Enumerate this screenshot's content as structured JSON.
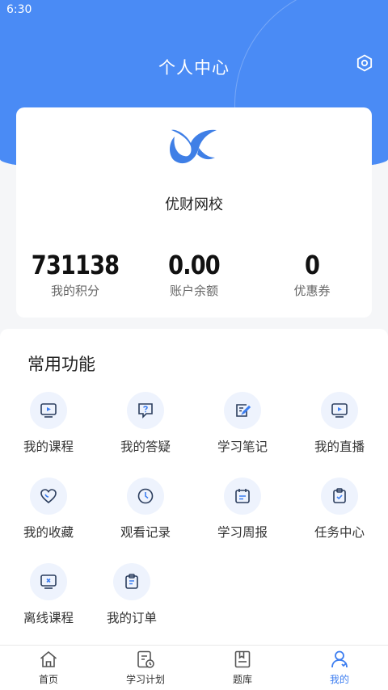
{
  "status_bar": {
    "time": "6:30"
  },
  "header": {
    "title": "个人中心"
  },
  "profile": {
    "school_name": "优财网校",
    "stats": [
      {
        "value": "731138",
        "label": "我的积分"
      },
      {
        "value": "0.00",
        "label": "账户余额"
      },
      {
        "value": "0",
        "label": "优惠券"
      }
    ]
  },
  "functions": {
    "title": "常用功能",
    "items": [
      {
        "label": "我的课程",
        "icon": "video-play-icon"
      },
      {
        "label": "我的答疑",
        "icon": "question-chat-icon"
      },
      {
        "label": "学习笔记",
        "icon": "note-edit-icon"
      },
      {
        "label": "我的直播",
        "icon": "live-tv-icon"
      },
      {
        "label": "我的收藏",
        "icon": "heart-icon"
      },
      {
        "label": "观看记录",
        "icon": "clock-icon"
      },
      {
        "label": "学习周报",
        "icon": "calendar-icon"
      },
      {
        "label": "任务中心",
        "icon": "clipboard-check-icon"
      },
      {
        "label": "离线课程",
        "icon": "offline-screen-icon"
      },
      {
        "label": "我的订单",
        "icon": "order-list-icon"
      }
    ]
  },
  "tabbar": {
    "tabs": [
      {
        "label": "首页",
        "icon": "home-icon"
      },
      {
        "label": "学习计划",
        "icon": "study-plan-icon"
      },
      {
        "label": "题库",
        "icon": "question-bank-icon"
      },
      {
        "label": "我的",
        "icon": "user-icon"
      }
    ],
    "active_index": 3
  },
  "colors": {
    "accent": "#4a8bf5",
    "active_tab": "#3d7ef0",
    "icon_bg": "#eef3fd"
  }
}
